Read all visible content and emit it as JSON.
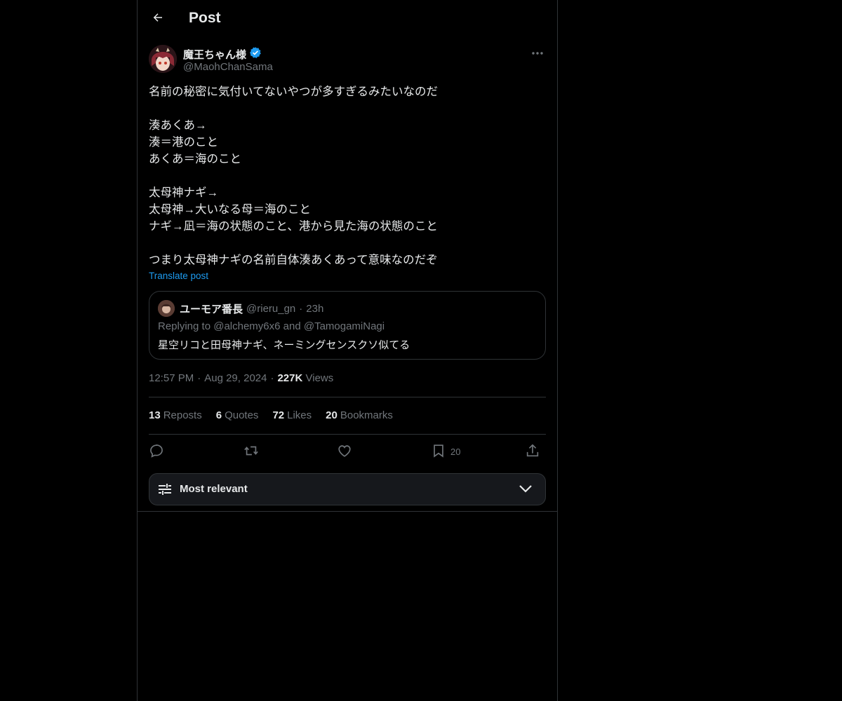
{
  "header": {
    "title": "Post"
  },
  "author": {
    "display_name": "魔王ちゃん様",
    "handle": "@MaohChanSama",
    "verified": true
  },
  "post": {
    "lines": [
      "名前の秘密に気付いてないやつが多すぎるみたいなのだ",
      "",
      "湊あくあ→",
      "湊＝港のこと",
      "あくあ＝海のこと",
      "",
      "太母神ナギ→",
      "太母神→大いなる母＝海のこと",
      "ナギ→凪＝海の状態のこと、港から見た海の状態のこと",
      "",
      "つまり太母神ナギの名前自体湊あくあって意味なのだぞ"
    ],
    "translate_label": "Translate post"
  },
  "quote": {
    "display_name": "ユーモア番長",
    "handle": "@rieru_gn",
    "separator": "·",
    "time": "23h",
    "replying_to": "Replying to @alchemy6x6 and @TamogamiNagi",
    "text": "星空リコと田母神ナギ、ネーミングセンスクソ似てる"
  },
  "meta": {
    "time": "12:57 PM",
    "dot": "·",
    "date": "Aug 29, 2024",
    "views_count": "227K",
    "views_label": "Views"
  },
  "stats": [
    {
      "count": "13",
      "label": "Reposts"
    },
    {
      "count": "6",
      "label": "Quotes"
    },
    {
      "count": "72",
      "label": "Likes"
    },
    {
      "count": "20",
      "label": "Bookmarks"
    }
  ],
  "actions": {
    "bookmark_count": "20"
  },
  "sort": {
    "label": "Most relevant"
  },
  "colors": {
    "background": "#000000",
    "accent": "#1d9bf0",
    "text": "#e7e9ea",
    "muted": "#71767b",
    "border": "#2f3336"
  },
  "icons": [
    "back-arrow-icon",
    "verified-badge-icon",
    "more-icon",
    "reply-icon",
    "repost-icon",
    "like-icon",
    "bookmark-icon",
    "share-icon",
    "sliders-icon",
    "chevron-down-icon"
  ]
}
